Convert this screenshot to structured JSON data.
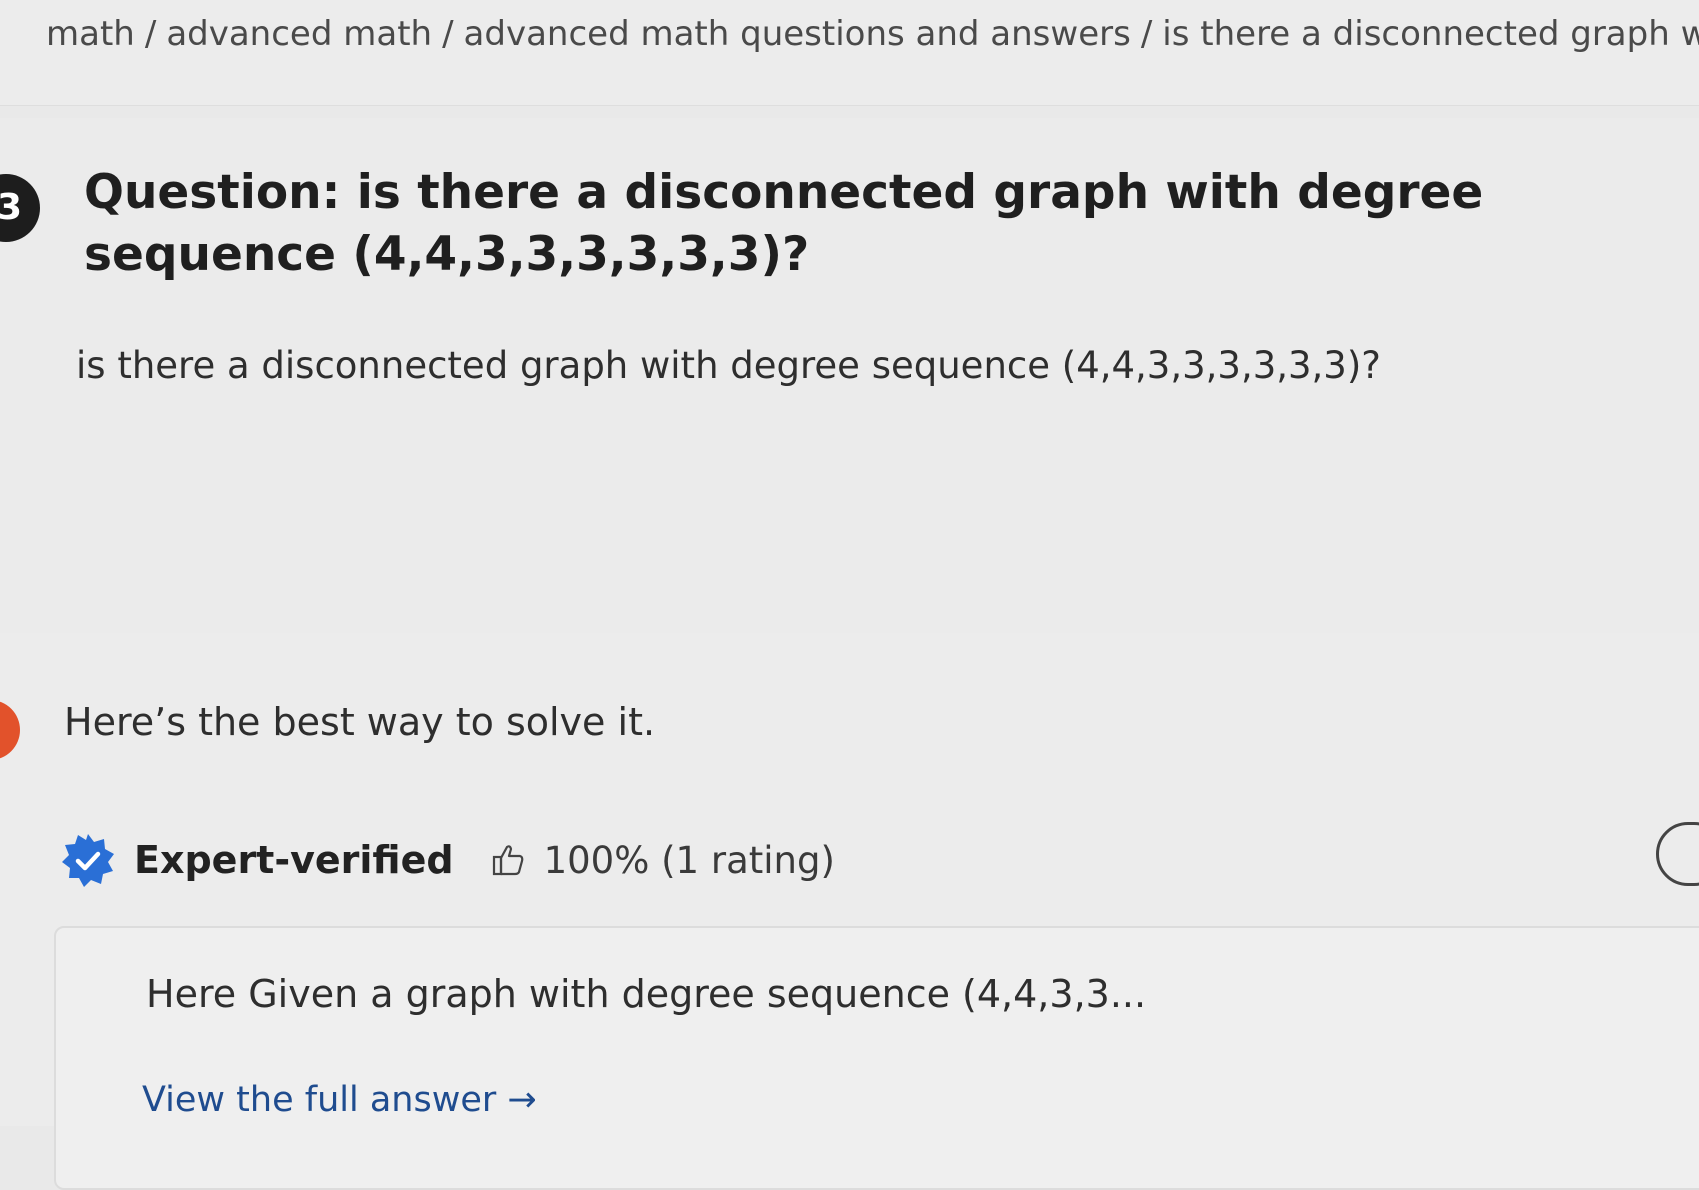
{
  "breadcrumb": {
    "items": [
      "math",
      "advanced math",
      "advanced math questions and answers",
      "is there a disconnected graph with c"
    ],
    "separator": "/"
  },
  "question": {
    "step_number": "3",
    "title": "Question: is there a disconnected graph with degree sequence (4,4,3,3,3,3,3,3)?",
    "body": "is there a disconnected graph with degree sequence (4,4,3,3,3,3,3,3)?"
  },
  "answer": {
    "heading": "Here’s the best way to solve it.",
    "verified_label": "Expert-verified",
    "rating": "100% (1 rating)",
    "preview": "Here Given a  graph with degree sequence (4,4,3,3...",
    "view_full": "View the full answer →",
    "badge_icon": "verified-badge-icon",
    "thumb_icon": "thumbs-up-icon"
  },
  "colors": {
    "accent_orange": "#e2522b",
    "badge_blue": "#2a6fd6",
    "link_blue": "#1f4c8f"
  }
}
